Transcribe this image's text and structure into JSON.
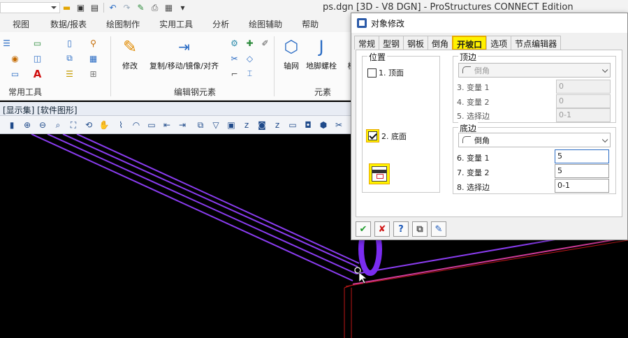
{
  "app": {
    "title": "ps.dgn [3D - V8 DGN] - ProStructures CONNECT Edition"
  },
  "quick_access": [
    "folder-icon",
    "save-icon",
    "save-as-icon",
    "undo-icon",
    "redo-icon",
    "pin-icon",
    "print-icon",
    "properties-icon",
    "more-icon"
  ],
  "ribbon": {
    "tabs": [
      "视图",
      "数据/报表",
      "绘图制作",
      "实用工具",
      "分析",
      "绘图辅助",
      "帮助"
    ],
    "groups": {
      "common_tools": "常用工具",
      "edit_steel": "编辑钢元素",
      "elements": "元素"
    },
    "buttons": {
      "modify": "修改",
      "copy_move": "复制/移动/镜像/对齐",
      "axis_grid": "轴网",
      "anchor_bolt": "地脚螺栓",
      "column": "柱"
    }
  },
  "view": {
    "title": "[显示集] [软件图形]",
    "toolbar_icons": [
      "brush-icon",
      "zoom-in-icon",
      "zoom-out-icon",
      "window-area-icon",
      "fit-view-icon",
      "rotate-view-icon",
      "pan-icon",
      "walk-icon",
      "fly-icon",
      "previous-view-icon",
      "next-view-icon",
      "copy-view-icon",
      "view-display-icon",
      "display-style-icon",
      "clip-volume-icon",
      "camera-icon",
      "cube-icon",
      "tools-icon",
      "more-icon"
    ]
  },
  "dialog": {
    "title": "对象修改",
    "tabs": [
      "常规",
      "型钢",
      "钢板",
      "倒角",
      "开坡口",
      "选项",
      "节点编辑器"
    ],
    "active_tab": "开坡口",
    "position": {
      "legend": "位置",
      "top_face": "1. 顶面",
      "top_face_checked": false,
      "bottom_face": "2. 底面",
      "bottom_face_checked": true
    },
    "top_edge": {
      "legend": "顶边",
      "type": "倒角",
      "var1_label": "3. 变量 1",
      "var1": "0",
      "var2_label": "4. 变量 2",
      "var2": "0",
      "edge_label": "5. 选择边",
      "edge": "0-1"
    },
    "bottom_edge": {
      "legend": "底边",
      "type": "倒角",
      "var1_label": "6. 变量 1",
      "var1": "5",
      "var2_label": "7. 变量 2",
      "var2": "5",
      "edge_label": "8. 选择边",
      "edge": "0-1"
    },
    "buttons": [
      "ok-check-icon",
      "cancel-x-icon",
      "help-icon",
      "copy-settings-icon",
      "edit-icon"
    ]
  },
  "colors": {
    "highlight": "#fff200",
    "beam_purple": "#8a3cf0",
    "beam_magenta": "#d03a9a",
    "edge_red": "#c01818"
  }
}
